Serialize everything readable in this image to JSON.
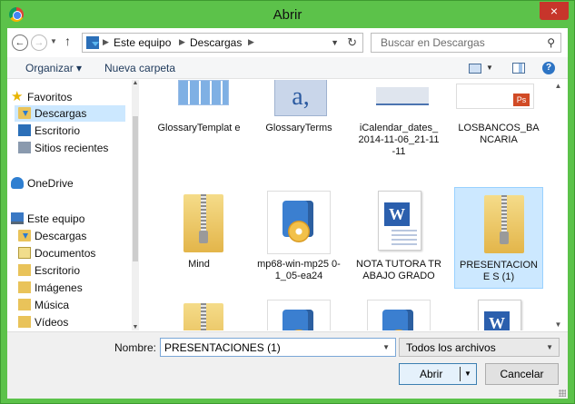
{
  "window": {
    "title": "Abrir",
    "close_label": "×"
  },
  "nav": {
    "back_label": "←",
    "forward_label": "→",
    "up_label": "↑",
    "breadcrumb": [
      "Este equipo",
      "Descargas"
    ],
    "search_placeholder": "Buscar en Descargas"
  },
  "toolbar": {
    "organize_label": "Organizar ▾",
    "new_folder_label": "Nueva carpeta",
    "help_label": "?"
  },
  "sidebar": {
    "items": [
      {
        "label": "Favoritos",
        "icon": "star-icon"
      },
      {
        "label": "Descargas",
        "icon": "downloads-folder-icon",
        "selected": true
      },
      {
        "label": "Escritorio",
        "icon": "desktop-icon"
      },
      {
        "label": "Sitios recientes",
        "icon": "recent-places-icon"
      },
      {
        "label": "OneDrive",
        "icon": "onedrive-icon"
      },
      {
        "label": "Este equipo",
        "icon": "computer-icon"
      },
      {
        "label": "Descargas",
        "icon": "downloads-folder-icon"
      },
      {
        "label": "Documentos",
        "icon": "documents-icon"
      },
      {
        "label": "Escritorio",
        "icon": "desktop-icon"
      },
      {
        "label": "Imágenes",
        "icon": "pictures-icon"
      },
      {
        "label": "Música",
        "icon": "music-icon"
      },
      {
        "label": "Vídeos",
        "icon": "videos-icon"
      }
    ]
  },
  "files": [
    {
      "name": "GlossaryTemplat e",
      "icon": "template-thumbnail-icon"
    },
    {
      "name": "GlossaryTerms",
      "icon": "glossary-document-icon"
    },
    {
      "name": "iCalendar_dates_ 2014-11-06_21-11 -11",
      "icon": "calendar-file-icon"
    },
    {
      "name": "LOSBANCOS_BA NCARIA",
      "icon": "pdf-thumbnail-icon"
    },
    {
      "name": "Mind",
      "icon": "zip-folder-icon"
    },
    {
      "name": "mp68-win-mp25 0-1_05-ea24",
      "icon": "setup-installer-icon"
    },
    {
      "name": "NOTA TUTORA TRABAJO GRADO",
      "icon": "word-document-icon"
    },
    {
      "name": "PRESENTACIONE S (1)",
      "icon": "zip-folder-icon",
      "selected": true
    },
    {
      "name": "",
      "icon": "zip-folder-icon"
    },
    {
      "name": "",
      "icon": "setup-installer-icon"
    },
    {
      "name": "",
      "icon": "setup-installer-icon"
    },
    {
      "name": "",
      "icon": "word-document-icon"
    }
  ],
  "footer": {
    "filename_label": "Nombre:",
    "filename_value": "PRESENTACIONES (1)",
    "filetype_value": "Todos los archivos",
    "open_label": "Abrir",
    "cancel_label": "Cancelar"
  }
}
